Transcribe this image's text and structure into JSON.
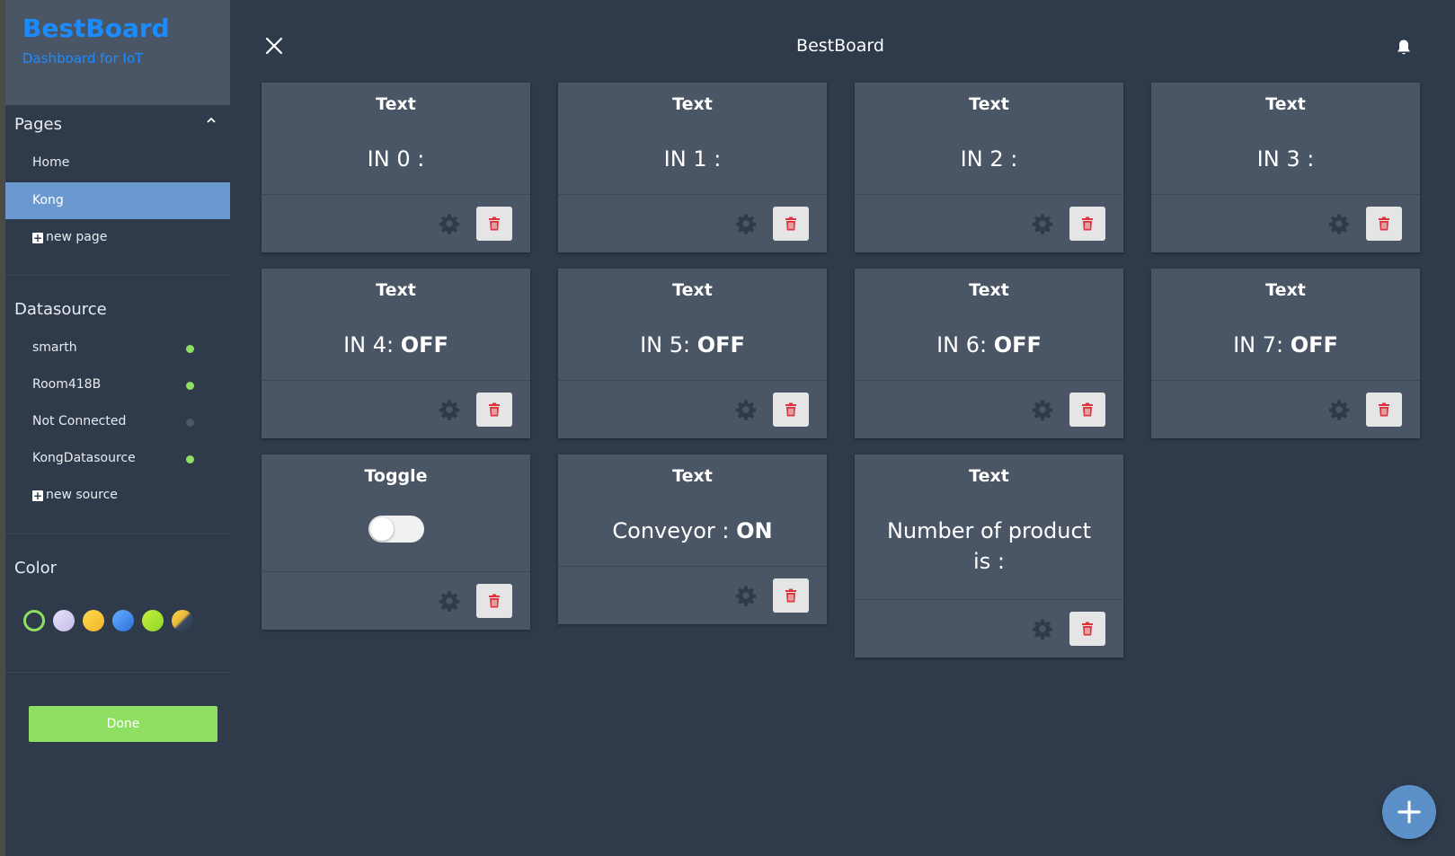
{
  "brand": {
    "title": "BestBoard",
    "subtitle": "Dashboard for IoT"
  },
  "header": {
    "title": "BestBoard"
  },
  "sidebar": {
    "pages_title": "Pages",
    "pages": [
      {
        "label": "Home",
        "active": false
      },
      {
        "label": "Kong",
        "active": true
      }
    ],
    "new_page_label": "new page",
    "datasource_title": "Datasource",
    "sources": [
      {
        "label": "smarth",
        "status_color": "#8fe062"
      },
      {
        "label": "Room418B",
        "status_color": "#8fe062"
      },
      {
        "label": "Not Connected",
        "status_color": "#4d5867"
      },
      {
        "label": "KongDatasource",
        "status_color": "#8fe062"
      }
    ],
    "new_source_label": "new source",
    "color_title": "Color",
    "swatches": [
      "#2f3b4b",
      "#d4cdf4",
      "#f7c940",
      "#3f8fe8",
      "#a8e334",
      "#f0c040"
    ],
    "done_label": "Done"
  },
  "widgets": [
    {
      "type": "Text",
      "label": "IN 0 :",
      "value": ""
    },
    {
      "type": "Text",
      "label": "IN 1 :",
      "value": ""
    },
    {
      "type": "Text",
      "label": "IN 2 :",
      "value": ""
    },
    {
      "type": "Text",
      "label": "IN 3 :",
      "value": ""
    },
    {
      "type": "Text",
      "label": "IN 4: ",
      "value": "OFF"
    },
    {
      "type": "Text",
      "label": "IN 5: ",
      "value": "OFF"
    },
    {
      "type": "Text",
      "label": "IN 6: ",
      "value": "OFF"
    },
    {
      "type": "Text",
      "label": "IN 7: ",
      "value": "OFF"
    },
    {
      "type": "Toggle",
      "label": "",
      "value": "",
      "on": false
    },
    {
      "type": "Text",
      "label": "Conveyor : ",
      "value": "ON"
    },
    {
      "type": "Text",
      "label": "Number of product is :",
      "value": ""
    }
  ],
  "colors": {
    "accent": "#1a8cff",
    "active": "#6b98cf",
    "done": "#8fe062",
    "delete": "#e0323c"
  },
  "icons": [
    "close-icon",
    "bell-icon",
    "chevron-up-icon",
    "gear-icon",
    "trash-icon",
    "plus-icon"
  ]
}
